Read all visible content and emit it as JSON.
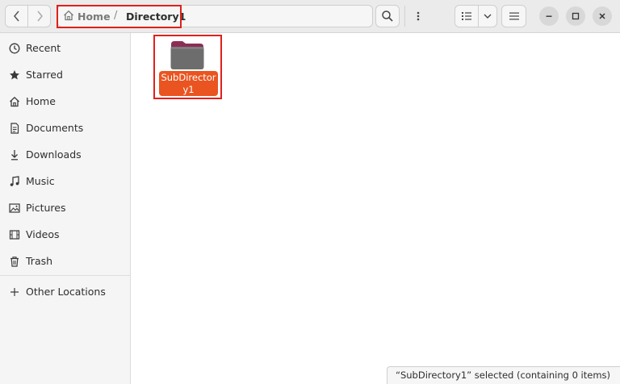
{
  "header": {
    "breadcrumbs": [
      {
        "label": "Home",
        "icon": "home-icon"
      },
      {
        "label": "Directory1"
      }
    ],
    "separator": "/"
  },
  "sidebar": {
    "items": [
      {
        "label": "Recent",
        "icon": "clock-icon"
      },
      {
        "label": "Starred",
        "icon": "star-icon"
      },
      {
        "label": "Home",
        "icon": "home-icon"
      },
      {
        "label": "Documents",
        "icon": "document-icon"
      },
      {
        "label": "Downloads",
        "icon": "download-icon"
      },
      {
        "label": "Music",
        "icon": "music-icon"
      },
      {
        "label": "Pictures",
        "icon": "picture-icon"
      },
      {
        "label": "Videos",
        "icon": "video-icon"
      },
      {
        "label": "Trash",
        "icon": "trash-icon"
      }
    ],
    "other_locations": {
      "label": "Other Locations",
      "icon": "plus-icon"
    }
  },
  "content": {
    "items": [
      {
        "name": "SubDirectory1",
        "type": "folder",
        "selected": true
      }
    ]
  },
  "status": {
    "text": "“SubDirectory1” selected  (containing 0 items)"
  },
  "colors": {
    "selection": "#e95420",
    "folder_top": "#8c2d56",
    "folder_body": "#6d6d6d",
    "highlight_box": "#e0201b"
  }
}
